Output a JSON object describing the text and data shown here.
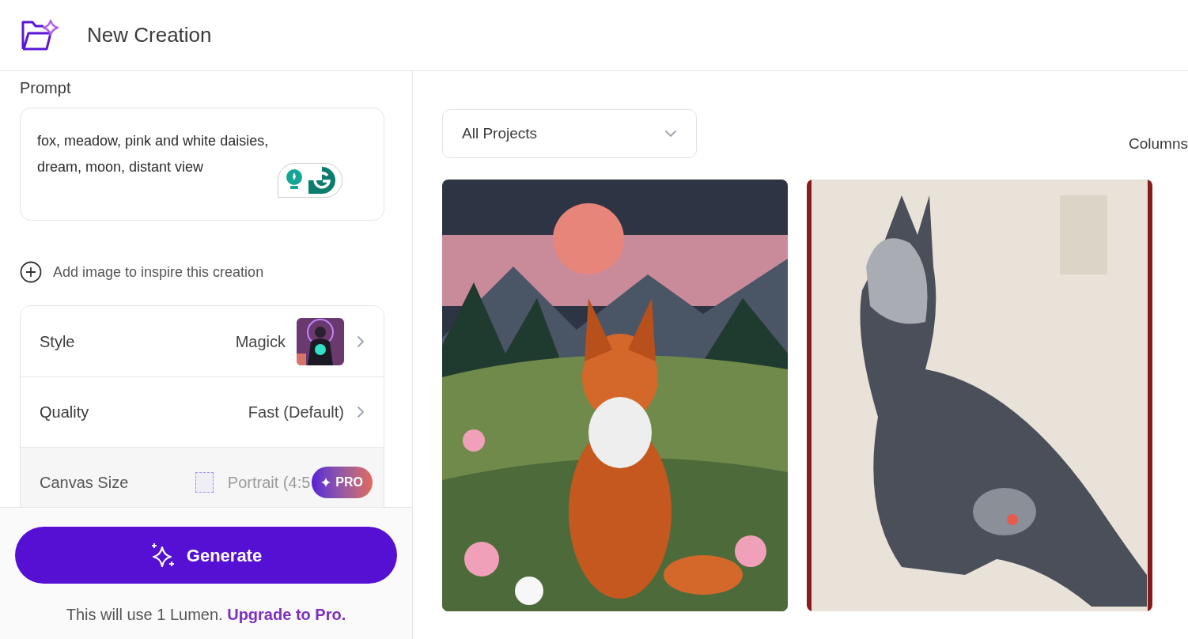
{
  "header": {
    "title": "New Creation"
  },
  "prompt": {
    "label": "Prompt",
    "value": "fox, meadow, pink and white daisies, dream, moon, distant view"
  },
  "add_image": {
    "label": "Add image to inspire this creation"
  },
  "settings": [
    {
      "kind": "style",
      "label": "Style",
      "value": "Magick",
      "disabled": false
    },
    {
      "kind": "quality",
      "label": "Quality",
      "value": "Fast (Default)",
      "disabled": false
    },
    {
      "kind": "canvas",
      "label": "Canvas Size",
      "value": "Portrait (4:5",
      "disabled": true,
      "badge": "PRO"
    }
  ],
  "generate": {
    "label": "Generate",
    "note": "This will use 1 Lumen.",
    "link": "Upgrade to Pro."
  },
  "gallery": {
    "filter": "All Projects",
    "columns_label": "Columns"
  }
}
